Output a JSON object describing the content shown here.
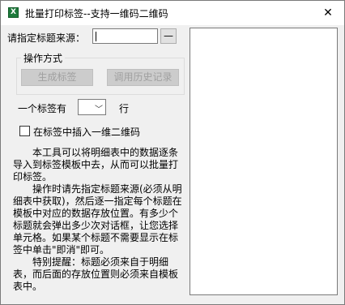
{
  "window": {
    "title": "批量打印标签--支持一维码二维码",
    "app_icon_glyph": "X",
    "close_glyph": "✕"
  },
  "source": {
    "label": "请指定标题来源：",
    "value": "",
    "browse_label": "—"
  },
  "operation_group": {
    "title": "操作方式",
    "generate_label": "生成标签",
    "history_label": "调用历史记录"
  },
  "per_row": {
    "prefix": "一个标签有",
    "selected": "",
    "suffix": "行"
  },
  "barcode_option": {
    "label": "在标签中插入一维二维码",
    "checked": false
  },
  "help": {
    "p1": "　　本工具可以将明细表中的数据逐条导入到标签模板中去，从而可以批量打印标签。",
    "p2": "　　操作时请先指定标题来源(必须从明细表中获取)，然后逐一指定每个标题在模板中对应的数据存放位置。有多少个标题就会弹出多少次对话框，让您选择单元格。如果某个标题不需要显示在标签中单击\"即消\"即可。",
    "p3": "　　特别提醒：标题必须来自于明细表，而后面的存放位置则必须来自模板表中。"
  },
  "colors": {
    "window_bg": "#f0f0f0",
    "disabled_button_bg": "#cccccc",
    "disabled_text": "#a0a0a0",
    "app_icon": "#1e7b3c"
  }
}
